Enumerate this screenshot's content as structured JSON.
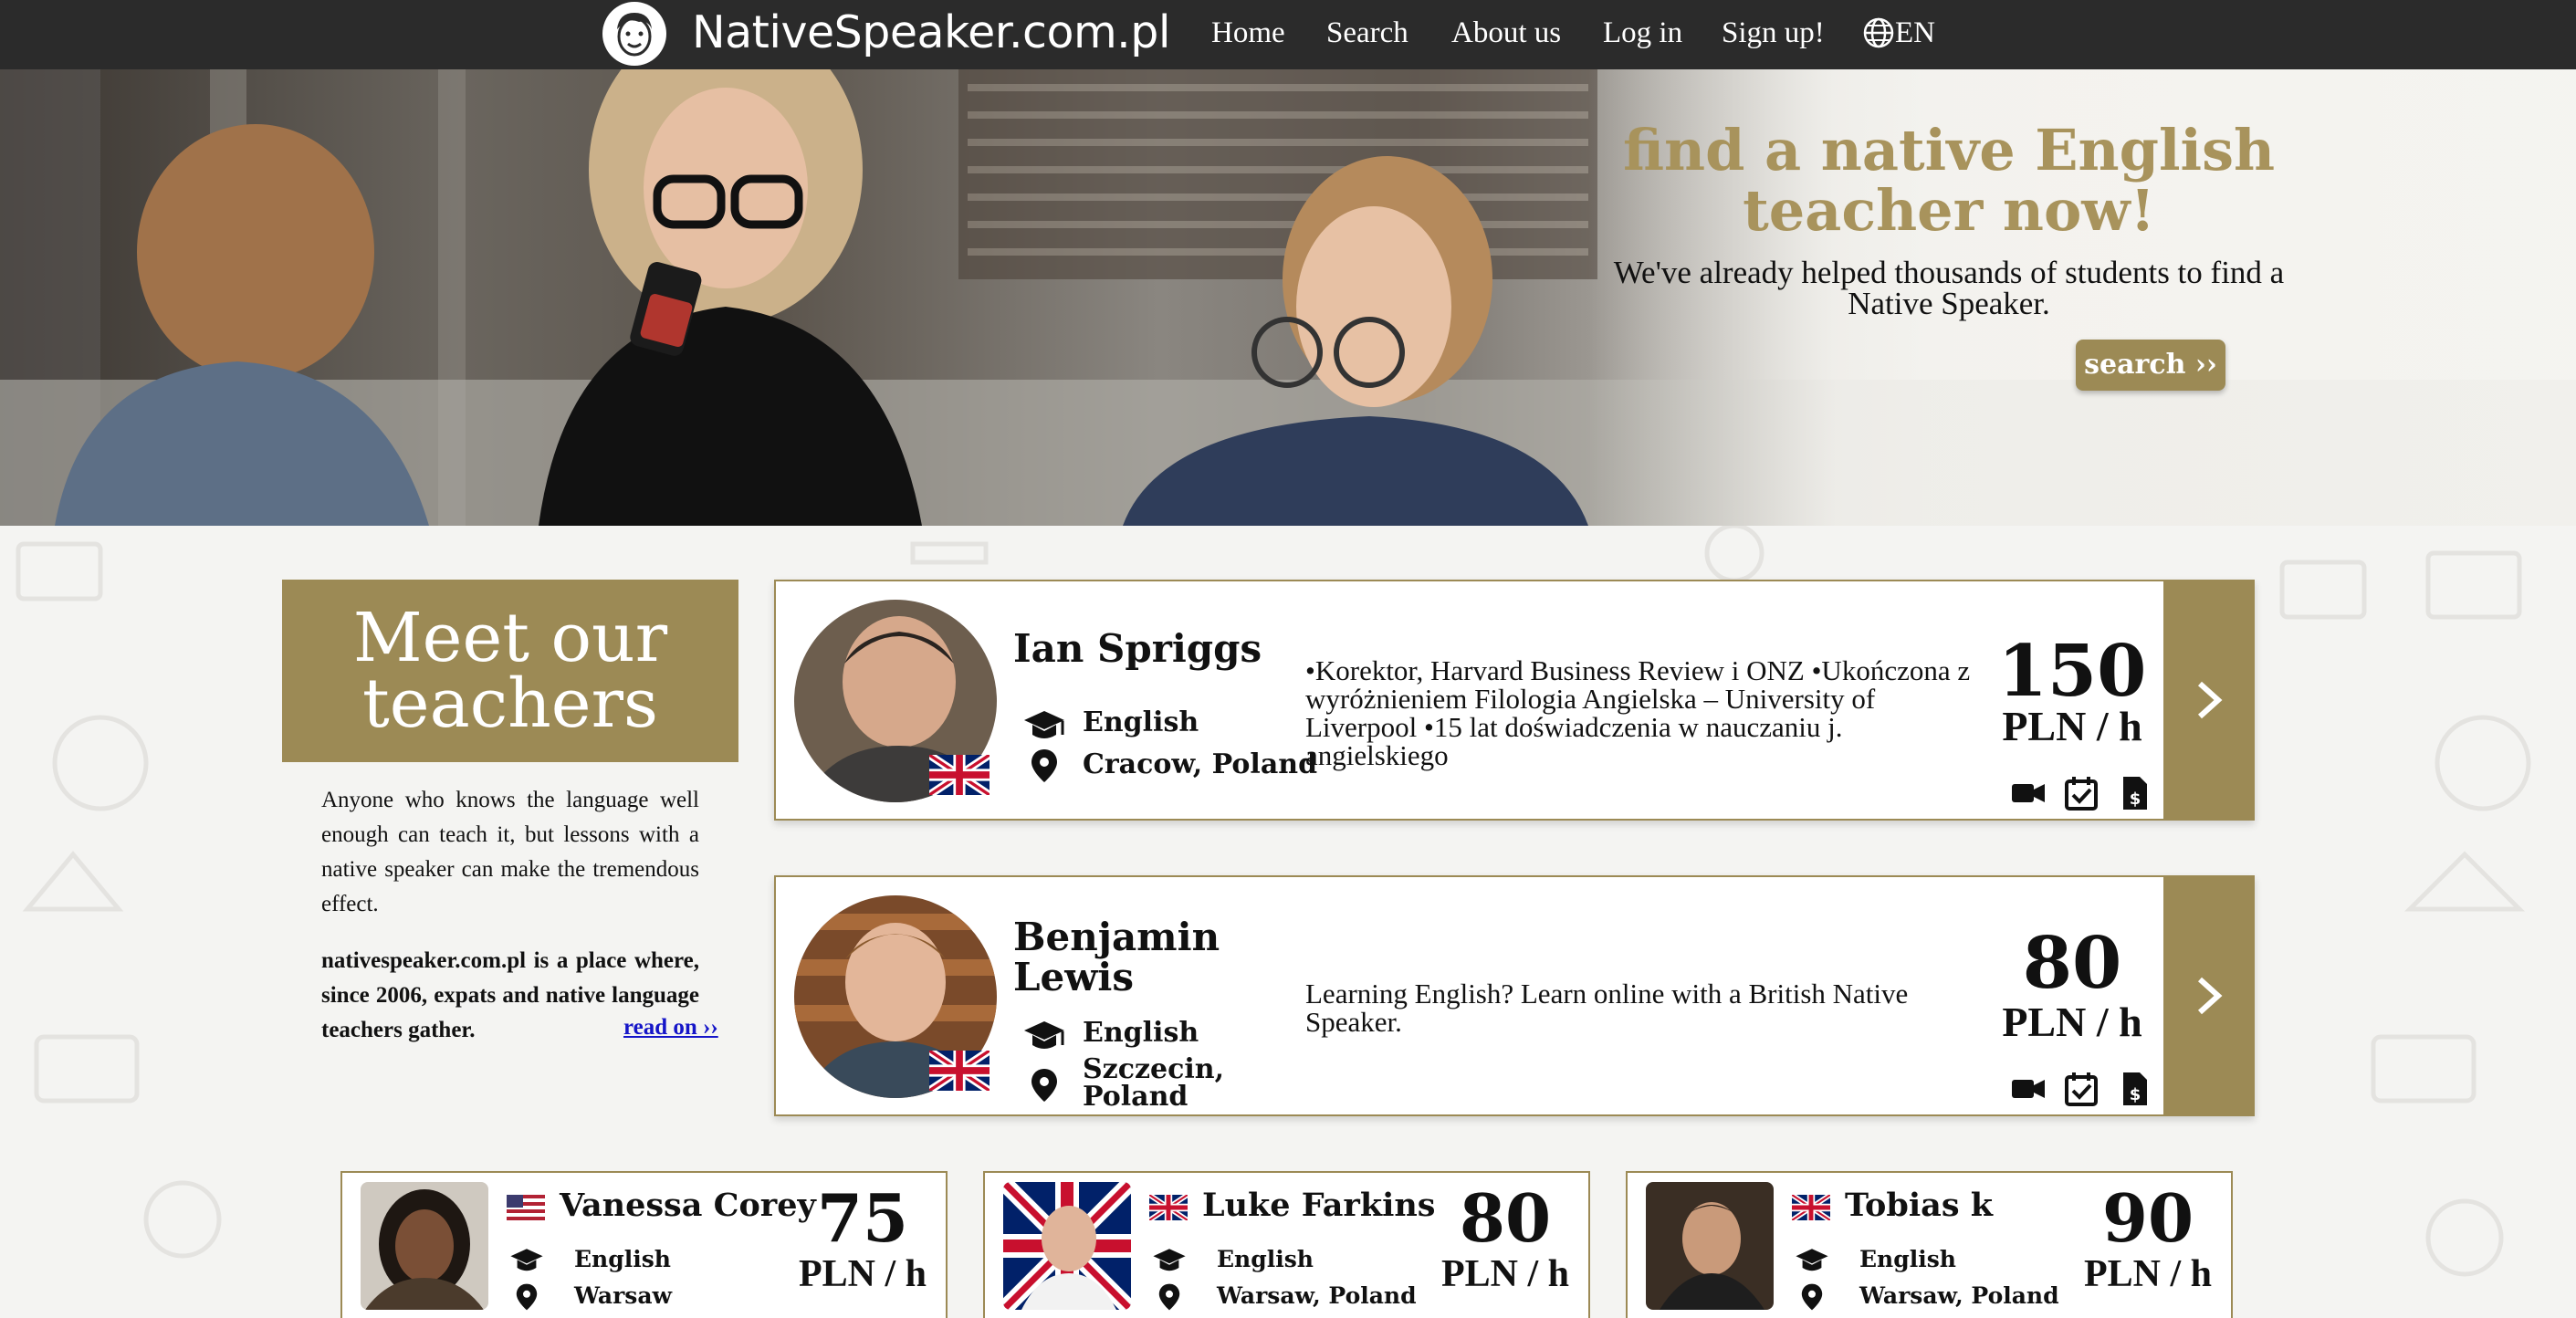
{
  "nav": {
    "logo_text": "NativeSpeaker.com.pl",
    "links": [
      "Home",
      "Search",
      "About us",
      "Log in",
      "Sign up!"
    ],
    "language": "EN",
    "icons": [
      "face-logo-icon",
      "globe-icon"
    ]
  },
  "hero": {
    "title": "find a native English teacher now!",
    "subtitle": "We've already helped thousands of students to find a Native Speaker.",
    "search_button": "search ››"
  },
  "sidebar": {
    "heading": "Meet our teachers",
    "paragraph1": "Anyone who knows the language well enough can teach it, but lessons with a native speaker can make the tremendous effect.",
    "paragraph2": "nativespeaker.com.pl is a place where, since 2006, expats and native language teachers gather.",
    "read_on": "read on ››"
  },
  "featured_teachers": [
    {
      "name": "Ian Spriggs",
      "language": "English",
      "location": "Cracow, Poland",
      "flag": "uk-flag",
      "description": "•Korektor, Harvard Business Review i ONZ •Ukończona z wyróżnieniem Filologia Angielska – University of Liverpool •15 lat doświadczenia w nauczaniu j. angielskiego",
      "price": "150",
      "unit": "PLN / h"
    },
    {
      "name": "Benjamin Lewis",
      "language": "English",
      "location": "Szczecin, Poland",
      "flag": "uk-flag",
      "description": "Learning English? Learn online with a British Native Speaker.",
      "price": "80",
      "unit": "PLN / h"
    }
  ],
  "teachers": [
    {
      "name": "Vanessa Corey",
      "flag": "us-flag",
      "language": "English",
      "location": "Warsaw",
      "price": "75",
      "unit": "PLN / h"
    },
    {
      "name": "Luke Farkins",
      "flag": "uk-flag",
      "language": "English",
      "location": "Warsaw, Poland",
      "price": "80",
      "unit": "PLN / h"
    },
    {
      "name": "Tobias k",
      "flag": "uk-flag",
      "language": "English",
      "location": "Warsaw, Poland",
      "price": "90",
      "unit": "PLN / h"
    }
  ],
  "colors": {
    "accent": "#9c8a55",
    "hero_title": "#a8935c",
    "nav_bg": "#2b2b2b",
    "link": "#1515c8"
  }
}
